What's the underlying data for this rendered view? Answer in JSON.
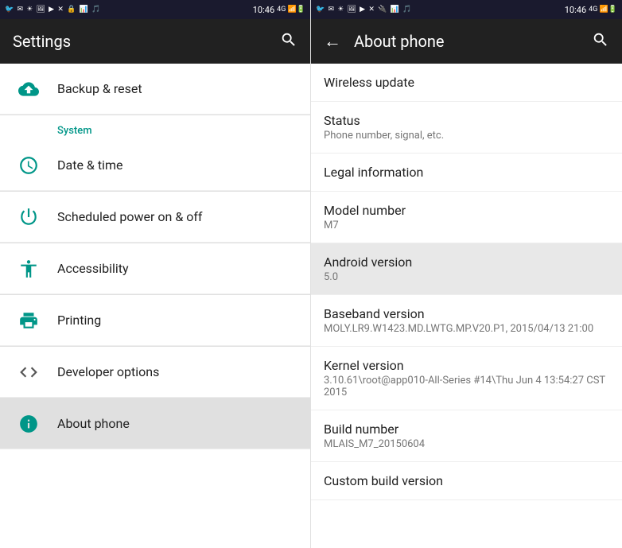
{
  "left": {
    "statusBar": {
      "left": "🐦 ✉ ☆ 🖼 ▶ ✕ 🔒 📊 🎵",
      "time": "10:46",
      "right": "4G↑ 📶 🔋"
    },
    "toolbar": {
      "title": "Settings",
      "searchIcon": "🔍"
    },
    "items": [
      {
        "id": "backup-reset",
        "icon": "backup",
        "primary": "Backup & reset",
        "secondary": ""
      }
    ],
    "sectionHeader": "System",
    "systemItems": [
      {
        "id": "date-time",
        "icon": "clock",
        "primary": "Date & time",
        "secondary": ""
      },
      {
        "id": "scheduled-power",
        "icon": "power",
        "primary": "Scheduled power on & off",
        "secondary": ""
      },
      {
        "id": "accessibility",
        "icon": "accessibility",
        "primary": "Accessibility",
        "secondary": ""
      },
      {
        "id": "printing",
        "icon": "print",
        "primary": "Printing",
        "secondary": ""
      },
      {
        "id": "developer-options",
        "icon": "code",
        "primary": "Developer options",
        "secondary": ""
      },
      {
        "id": "about-phone",
        "icon": "info",
        "primary": "About phone",
        "secondary": "",
        "highlighted": true
      }
    ]
  },
  "right": {
    "statusBar": {
      "left": "🐦 ✉ ☆ 🖼 ▶ ✕ 🔌 📊 🎵",
      "time": "10:46",
      "right": "4G↑ 📶 🔋"
    },
    "toolbar": {
      "title": "About phone",
      "backIcon": "←",
      "searchIcon": "🔍"
    },
    "items": [
      {
        "id": "wireless-update",
        "primary": "Wireless update",
        "secondary": ""
      },
      {
        "id": "status",
        "primary": "Status",
        "secondary": "Phone number, signal, etc."
      },
      {
        "id": "legal-information",
        "primary": "Legal information",
        "secondary": ""
      },
      {
        "id": "model-number",
        "primary": "Model number",
        "secondary": "M7"
      },
      {
        "id": "android-version",
        "primary": "Android version",
        "secondary": "5.0",
        "highlighted": true
      },
      {
        "id": "baseband-version",
        "primary": "Baseband version",
        "secondary": "MOLY.LR9.W1423.MD.LWTG.MP.V20.P1, 2015/04/13 21:00"
      },
      {
        "id": "kernel-version",
        "primary": "Kernel version",
        "secondary": "3.10.61\\root@app010-All-Series #14\\Thu Jun 4 13:54:27 CST 2015"
      },
      {
        "id": "build-number",
        "primary": "Build number",
        "secondary": "MLAIS_M7_20150604"
      },
      {
        "id": "custom-build-version",
        "primary": "Custom build version",
        "secondary": ""
      }
    ]
  }
}
